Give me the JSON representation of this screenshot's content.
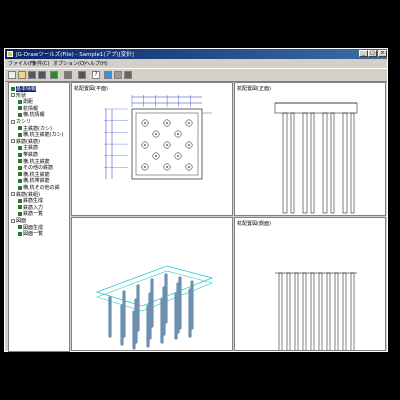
{
  "window": {
    "title": "JG-Drawツールズ(File) - Sample1(アプ)[変針]",
    "controls": [
      "_",
      "□",
      "×"
    ]
  },
  "menu": [
    "ファイル(F)",
    "条件(C)",
    "オプション(O)",
    "ヘルプ(H)"
  ],
  "toolbar": {
    "icons": [
      "new-icon",
      "open-icon",
      "save-icon",
      "save-as-icon",
      "export-icon",
      "print-icon",
      "preview-icon",
      "help-icon",
      "view1-icon",
      "view2-icon",
      "view3-icon"
    ]
  },
  "tree": {
    "items": [
      {
        "label": "基本情報",
        "indent": 1,
        "selected": true
      },
      {
        "label": "形状",
        "indent": 1,
        "expander": "-"
      },
      {
        "label": "測距",
        "indent": 2
      },
      {
        "label": "杭情報",
        "indent": 2
      },
      {
        "label": "横,杭情報",
        "indent": 2
      },
      {
        "label": "カシリ",
        "indent": 1,
        "expander": "-"
      },
      {
        "label": "主鉄筋(カシ)",
        "indent": 2
      },
      {
        "label": "横,杭主鉄筋(カシ)",
        "indent": 2
      },
      {
        "label": "鉄筋(鉄筋)",
        "indent": 1,
        "expander": "-"
      },
      {
        "label": "主鉄筋",
        "indent": 2
      },
      {
        "label": "帯鉄筋",
        "indent": 2
      },
      {
        "label": "横,杭主鉄筋",
        "indent": 2
      },
      {
        "label": "その他の鉄筋",
        "indent": 2
      },
      {
        "label": "横,杭主鉄筋",
        "indent": 2
      },
      {
        "label": "横,杭帯鉄筋",
        "indent": 2
      },
      {
        "label": "横,杭その他の鉄",
        "indent": 2
      },
      {
        "label": "鉄筋(鉄組)",
        "indent": 1,
        "expander": "-"
      },
      {
        "label": "鉄筋生成",
        "indent": 2
      },
      {
        "label": "鉄筋入力",
        "indent": 2
      },
      {
        "label": "鉄筋一覧",
        "indent": 2
      },
      {
        "label": "図面",
        "indent": 1,
        "expander": "-"
      },
      {
        "label": "図面生成",
        "indent": 2
      },
      {
        "label": "図面一覧",
        "indent": 2
      }
    ]
  },
  "panes": {
    "plan_title": "杭配置図(平面)",
    "front_title": "杭配置図(正面)",
    "side_title": "杭配置図(側面)"
  },
  "colors": {
    "title_start": "#0a246a",
    "title_end": "#3a6ea5",
    "dim_blue": "#2233cc",
    "pile_3d": "#6f8faf",
    "cap_outline": "#22cccc"
  }
}
